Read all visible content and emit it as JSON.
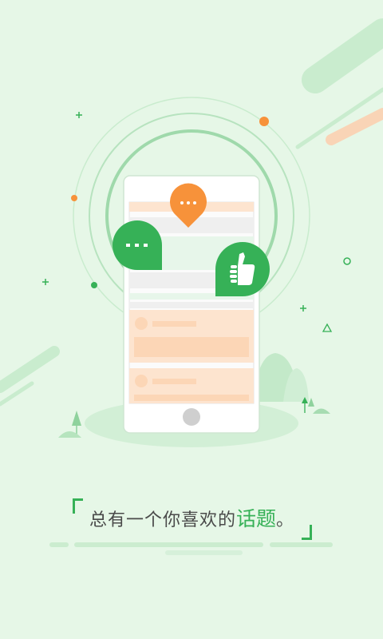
{
  "caption": {
    "prefix": "总有一个你喜欢的",
    "highlight": "话题",
    "suffix": "。"
  },
  "icons": [
    "chat-bubble-icon",
    "thumbs-up-icon",
    "home-button-icon"
  ],
  "colors": {
    "background": "#e6f7e7",
    "accent_green": "#36b157",
    "accent_orange": "#f7923a",
    "light_green": "#c9ecce",
    "peach": "#fde4cf"
  }
}
